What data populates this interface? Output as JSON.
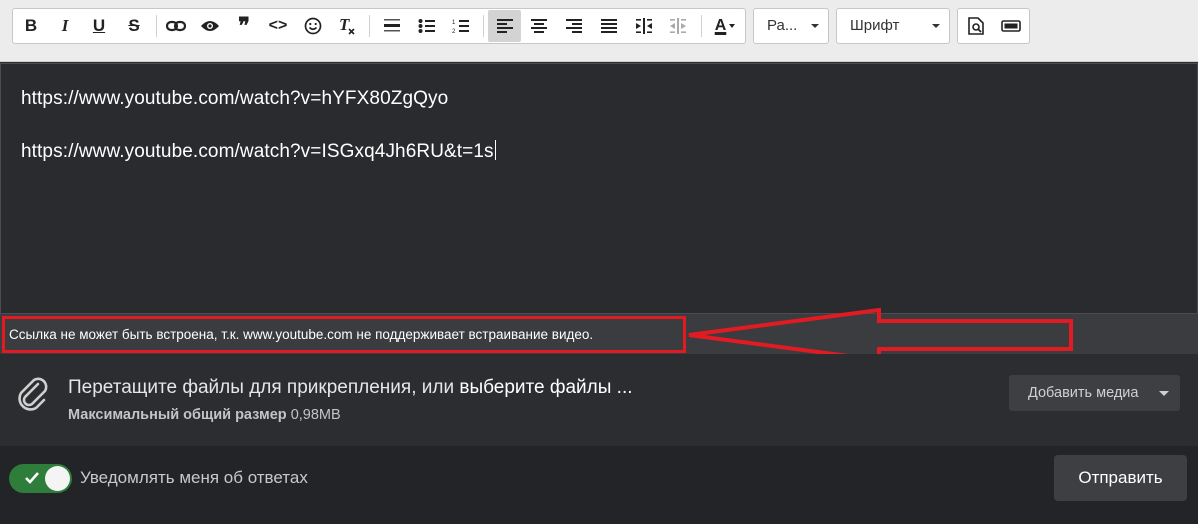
{
  "toolbar": {
    "buttons": [
      "bold-icon",
      "italic-icon",
      "underline-icon",
      "strikethrough-icon",
      "link-icon",
      "eye-icon",
      "quote-icon",
      "code-icon",
      "smiley-icon",
      "clear-format-icon",
      "horizontal-rule-icon",
      "bulleted-list-icon",
      "numbered-list-icon",
      "align-left-icon",
      "align-center-icon",
      "align-right-icon",
      "align-justify-icon",
      "indent-icon",
      "outdent-icon",
      "text-color-icon",
      "preview-icon",
      "toggle-view-icon"
    ],
    "size_dropdown": "Ра...",
    "font_dropdown": "Шрифт",
    "bold_glyph": "B",
    "italic_glyph": "I",
    "underline_glyph": "U",
    "strike_glyph": "S",
    "quote_glyph": "❞",
    "code_glyph": "<>",
    "textcolor_glyph": "A"
  },
  "editor": {
    "lines": [
      "https://www.youtube.com/watch?v=hYFX80ZgQyo",
      "https://www.youtube.com/watch?v=ISGxq4Jh6RU&t=1s"
    ]
  },
  "notice": {
    "text": "Ссылка не может быть встроена, т.к. www.youtube.com не поддерживает встраивание видео.",
    "highlight_color": "#e21b23"
  },
  "attachments": {
    "prompt": "Перетащите файлы для прикрепления, или ",
    "select_link": "выберите файлы ...",
    "size_label": "Максимальный общий размер",
    "size_value": "0,98MB",
    "add_media": "Добавить медиа"
  },
  "footer": {
    "notify_label": "Уведомлять меня об ответах",
    "notify_enabled": true,
    "send_label": "Отправить"
  },
  "colors": {
    "toggle_on": "#2e7d3a",
    "editor_bg": "#2a2b2f",
    "toolbar_bg": "#ececec"
  }
}
